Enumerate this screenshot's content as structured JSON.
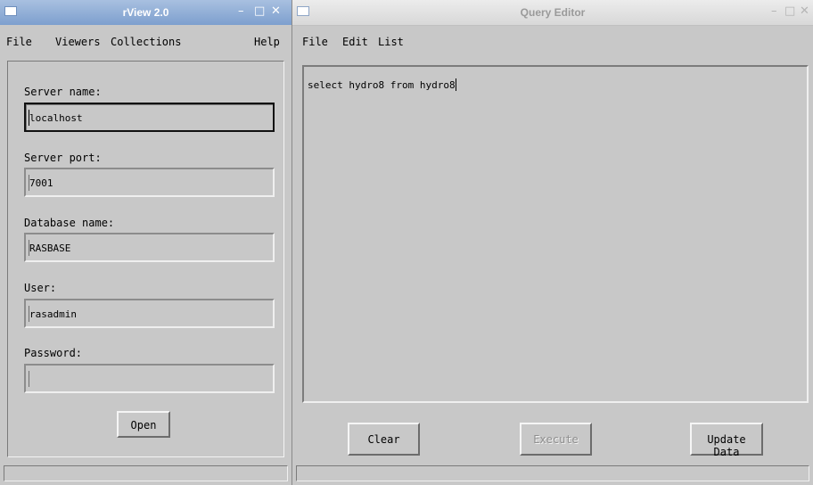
{
  "rview": {
    "title": "rView 2.0",
    "controls": {
      "minimize": "–",
      "maximize": "□",
      "close": "✕"
    },
    "menu": {
      "file": "File",
      "viewers": "Viewers",
      "collections": "Collections",
      "help": "Help"
    },
    "form": {
      "server_name": {
        "label": "Server name:",
        "value": "localhost"
      },
      "server_port": {
        "label": "Server port:",
        "value": "7001"
      },
      "database_name": {
        "label": "Database name:",
        "value": "RASBASE"
      },
      "user": {
        "label": "User:",
        "value": "rasadmin"
      },
      "password": {
        "label": "Password:",
        "value": ""
      }
    },
    "open_label": "Open"
  },
  "query": {
    "title": "Query Editor",
    "controls": {
      "minimize": "–",
      "maximize": "□",
      "close": "✕"
    },
    "menu": {
      "file": "File",
      "edit": "Edit",
      "list": "List"
    },
    "text": "select hydro8 from hydro8",
    "buttons": {
      "clear": "Clear",
      "execute": "Execute",
      "update": "Update Data"
    }
  }
}
